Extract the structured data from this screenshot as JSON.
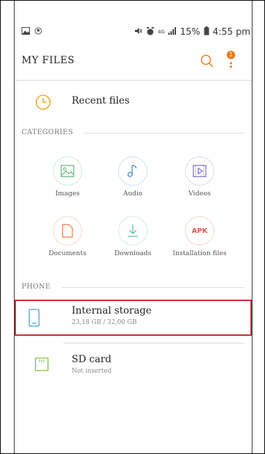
{
  "status_bar": {
    "signal_text": "4G",
    "battery_text": "15%",
    "time": "4:55 pm"
  },
  "app_bar": {
    "title": "MY FILES",
    "more_badge_count": "1"
  },
  "recent": {
    "label": "Recent files"
  },
  "categories": {
    "header": "CATEGORIES",
    "items": [
      {
        "label": "Images",
        "icon": "image-icon",
        "color": "#5bb377"
      },
      {
        "label": "Audio",
        "icon": "music-note-icon",
        "color": "#3d82c8"
      },
      {
        "label": "Videos",
        "icon": "video-icon",
        "color": "#8067c2"
      },
      {
        "label": "Documents",
        "icon": "document-icon",
        "color": "#f0753e"
      },
      {
        "label": "Downloads",
        "icon": "download-icon",
        "color": "#4fb8a0"
      },
      {
        "label": "Installation files",
        "icon": "apk-icon",
        "icon_text": "APK",
        "color": "#e8584f"
      }
    ]
  },
  "phone": {
    "header": "PHONE",
    "storage": [
      {
        "title": "Internal storage",
        "subtitle": "23,18 GB / 32,00 GB",
        "icon": "phone-storage-icon",
        "selected": true
      },
      {
        "title": "SD card",
        "subtitle": "Not inserted",
        "icon": "sd-card-icon",
        "selected": false
      }
    ]
  },
  "colors": {
    "accent": "#f07a1a",
    "selection_border": "#d0262e"
  }
}
